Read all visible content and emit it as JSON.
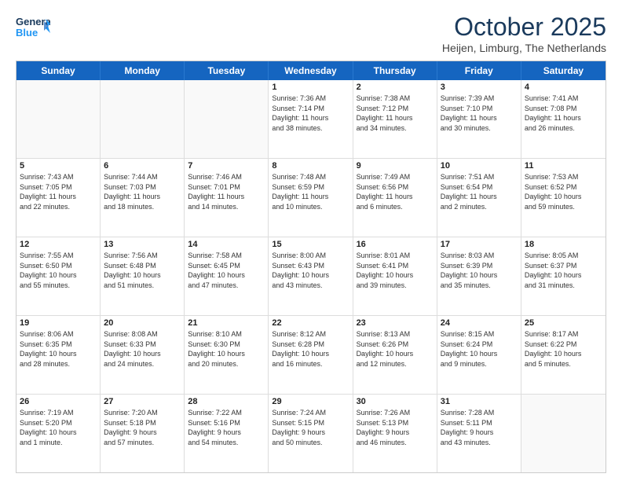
{
  "header": {
    "logo_general": "General",
    "logo_blue": "Blue",
    "title": "October 2025",
    "location": "Heijen, Limburg, The Netherlands"
  },
  "days_of_week": [
    "Sunday",
    "Monday",
    "Tuesday",
    "Wednesday",
    "Thursday",
    "Friday",
    "Saturday"
  ],
  "weeks": [
    [
      {
        "day": "",
        "info": ""
      },
      {
        "day": "",
        "info": ""
      },
      {
        "day": "",
        "info": ""
      },
      {
        "day": "1",
        "info": "Sunrise: 7:36 AM\nSunset: 7:14 PM\nDaylight: 11 hours\nand 38 minutes."
      },
      {
        "day": "2",
        "info": "Sunrise: 7:38 AM\nSunset: 7:12 PM\nDaylight: 11 hours\nand 34 minutes."
      },
      {
        "day": "3",
        "info": "Sunrise: 7:39 AM\nSunset: 7:10 PM\nDaylight: 11 hours\nand 30 minutes."
      },
      {
        "day": "4",
        "info": "Sunrise: 7:41 AM\nSunset: 7:08 PM\nDaylight: 11 hours\nand 26 minutes."
      }
    ],
    [
      {
        "day": "5",
        "info": "Sunrise: 7:43 AM\nSunset: 7:05 PM\nDaylight: 11 hours\nand 22 minutes."
      },
      {
        "day": "6",
        "info": "Sunrise: 7:44 AM\nSunset: 7:03 PM\nDaylight: 11 hours\nand 18 minutes."
      },
      {
        "day": "7",
        "info": "Sunrise: 7:46 AM\nSunset: 7:01 PM\nDaylight: 11 hours\nand 14 minutes."
      },
      {
        "day": "8",
        "info": "Sunrise: 7:48 AM\nSunset: 6:59 PM\nDaylight: 11 hours\nand 10 minutes."
      },
      {
        "day": "9",
        "info": "Sunrise: 7:49 AM\nSunset: 6:56 PM\nDaylight: 11 hours\nand 6 minutes."
      },
      {
        "day": "10",
        "info": "Sunrise: 7:51 AM\nSunset: 6:54 PM\nDaylight: 11 hours\nand 2 minutes."
      },
      {
        "day": "11",
        "info": "Sunrise: 7:53 AM\nSunset: 6:52 PM\nDaylight: 10 hours\nand 59 minutes."
      }
    ],
    [
      {
        "day": "12",
        "info": "Sunrise: 7:55 AM\nSunset: 6:50 PM\nDaylight: 10 hours\nand 55 minutes."
      },
      {
        "day": "13",
        "info": "Sunrise: 7:56 AM\nSunset: 6:48 PM\nDaylight: 10 hours\nand 51 minutes."
      },
      {
        "day": "14",
        "info": "Sunrise: 7:58 AM\nSunset: 6:45 PM\nDaylight: 10 hours\nand 47 minutes."
      },
      {
        "day": "15",
        "info": "Sunrise: 8:00 AM\nSunset: 6:43 PM\nDaylight: 10 hours\nand 43 minutes."
      },
      {
        "day": "16",
        "info": "Sunrise: 8:01 AM\nSunset: 6:41 PM\nDaylight: 10 hours\nand 39 minutes."
      },
      {
        "day": "17",
        "info": "Sunrise: 8:03 AM\nSunset: 6:39 PM\nDaylight: 10 hours\nand 35 minutes."
      },
      {
        "day": "18",
        "info": "Sunrise: 8:05 AM\nSunset: 6:37 PM\nDaylight: 10 hours\nand 31 minutes."
      }
    ],
    [
      {
        "day": "19",
        "info": "Sunrise: 8:06 AM\nSunset: 6:35 PM\nDaylight: 10 hours\nand 28 minutes."
      },
      {
        "day": "20",
        "info": "Sunrise: 8:08 AM\nSunset: 6:33 PM\nDaylight: 10 hours\nand 24 minutes."
      },
      {
        "day": "21",
        "info": "Sunrise: 8:10 AM\nSunset: 6:30 PM\nDaylight: 10 hours\nand 20 minutes."
      },
      {
        "day": "22",
        "info": "Sunrise: 8:12 AM\nSunset: 6:28 PM\nDaylight: 10 hours\nand 16 minutes."
      },
      {
        "day": "23",
        "info": "Sunrise: 8:13 AM\nSunset: 6:26 PM\nDaylight: 10 hours\nand 12 minutes."
      },
      {
        "day": "24",
        "info": "Sunrise: 8:15 AM\nSunset: 6:24 PM\nDaylight: 10 hours\nand 9 minutes."
      },
      {
        "day": "25",
        "info": "Sunrise: 8:17 AM\nSunset: 6:22 PM\nDaylight: 10 hours\nand 5 minutes."
      }
    ],
    [
      {
        "day": "26",
        "info": "Sunrise: 7:19 AM\nSunset: 5:20 PM\nDaylight: 10 hours\nand 1 minute."
      },
      {
        "day": "27",
        "info": "Sunrise: 7:20 AM\nSunset: 5:18 PM\nDaylight: 9 hours\nand 57 minutes."
      },
      {
        "day": "28",
        "info": "Sunrise: 7:22 AM\nSunset: 5:16 PM\nDaylight: 9 hours\nand 54 minutes."
      },
      {
        "day": "29",
        "info": "Sunrise: 7:24 AM\nSunset: 5:15 PM\nDaylight: 9 hours\nand 50 minutes."
      },
      {
        "day": "30",
        "info": "Sunrise: 7:26 AM\nSunset: 5:13 PM\nDaylight: 9 hours\nand 46 minutes."
      },
      {
        "day": "31",
        "info": "Sunrise: 7:28 AM\nSunset: 5:11 PM\nDaylight: 9 hours\nand 43 minutes."
      },
      {
        "day": "",
        "info": ""
      }
    ]
  ]
}
